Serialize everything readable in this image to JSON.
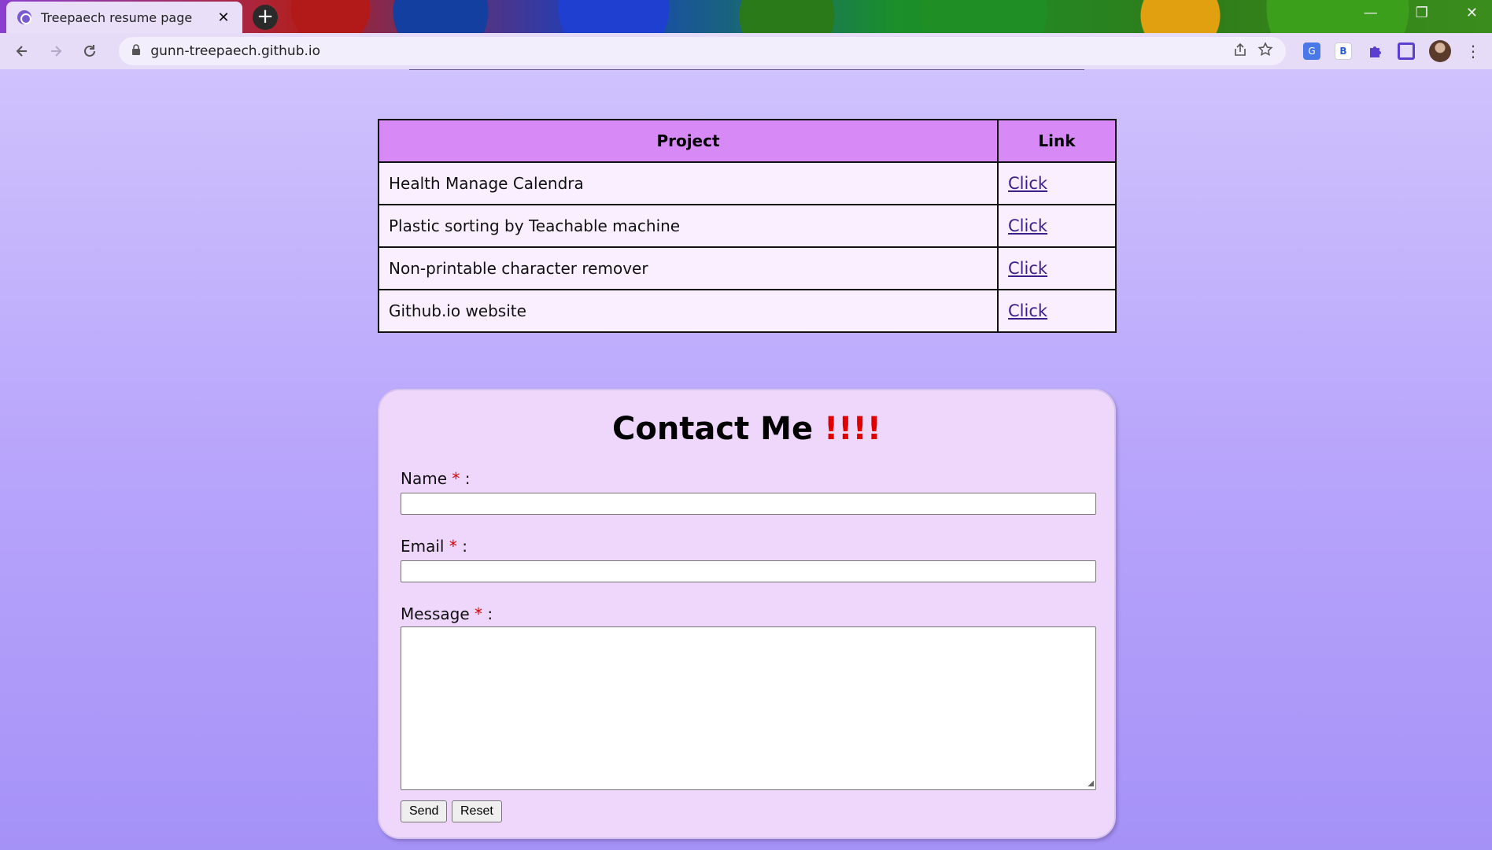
{
  "browser": {
    "tab_title": "Treepaech resume page",
    "tab_close": "✕",
    "new_tab": "+",
    "url": "gunn-treepaech.github.io",
    "window_controls": [
      "—",
      "❐",
      "✕"
    ],
    "icons": [
      "back-icon",
      "forward-icon",
      "reload-icon",
      "lock-icon",
      "share-icon",
      "star-icon",
      "translate-icon",
      "extension-b-icon",
      "puzzle-icon",
      "side-panel-icon",
      "avatar",
      "menu-icon"
    ],
    "extension_b_label": "B"
  },
  "projects": {
    "headers": {
      "project": "Project",
      "link": "Link"
    },
    "rows": [
      {
        "name": "Health Manage Calendra",
        "link": "Click"
      },
      {
        "name": "Plastic sorting by Teachable machine",
        "link": "Click"
      },
      {
        "name": "Non-printable character remover",
        "link": "Click"
      },
      {
        "name": "Github.io website",
        "link": "Click"
      }
    ]
  },
  "contact": {
    "title": "Contact Me",
    "title_bang": "!!!!",
    "required_mark": "*",
    "name_label": "Name",
    "email_label": "Email",
    "message_label": "Message",
    "colon": ":",
    "send": "Send",
    "reset": "Reset"
  },
  "colors": {
    "table_header": "#d789f6",
    "table_cell": "#f9efff",
    "contact_card": "#efd6fb",
    "required": "#e00000"
  }
}
